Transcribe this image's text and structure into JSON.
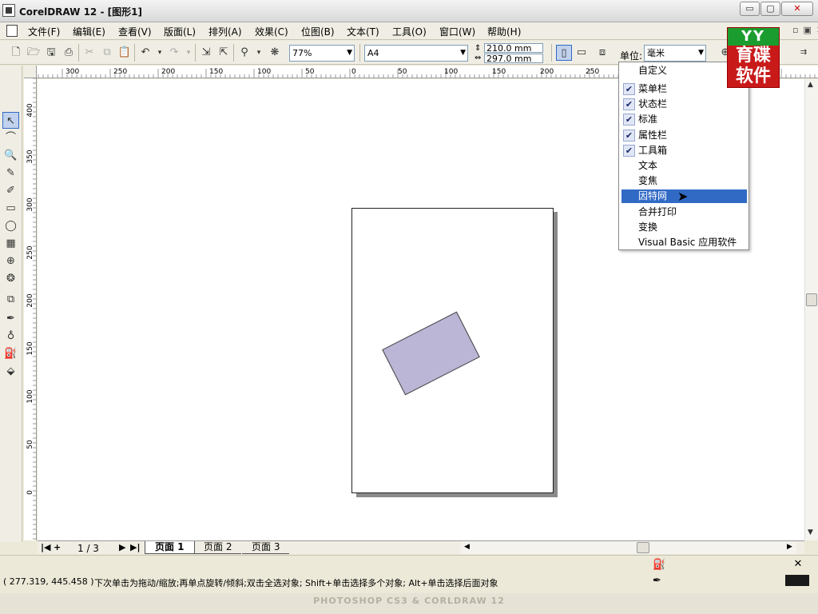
{
  "window": {
    "title": "CorelDRAW 12 - [图形1]",
    "min_glyph": "▭",
    "max_glyph": "▢",
    "close_glyph": "✕",
    "mdi_controls": "▫▣✕"
  },
  "menu": [
    "文件(F)",
    "编辑(E)",
    "查看(V)",
    "版面(L)",
    "排列(A)",
    "效果(C)",
    "位图(B)",
    "文本(T)",
    "工具(O)",
    "窗口(W)",
    "帮助(H)"
  ],
  "toolbar": {
    "zoom": "77%",
    "paper_size": "A4",
    "width": "210.0 mm",
    "height": "297.0 mm",
    "unit_label": "单位:",
    "unit_value": "毫米"
  },
  "logo": {
    "mark": "YY",
    "line1": "育碟",
    "line2": "软件"
  },
  "ruler_top_labels": [
    "300",
    "250",
    "200",
    "150",
    "100",
    "50",
    "0",
    "50",
    "100",
    "150",
    "200",
    "250"
  ],
  "ruler_left_labels": [
    "400",
    "350",
    "300",
    "250",
    "200",
    "150",
    "100",
    "50",
    "0"
  ],
  "dropdown": {
    "header": "自定义",
    "items": [
      {
        "label": "菜单栏",
        "checked": true
      },
      {
        "label": "状态栏",
        "checked": true
      },
      {
        "label": "标准",
        "checked": true
      },
      {
        "label": "属性栏",
        "checked": true
      },
      {
        "label": "工具箱",
        "checked": true
      },
      {
        "label": "文本",
        "checked": false
      },
      {
        "label": "变焦",
        "checked": false
      },
      {
        "label": "因特网",
        "checked": false,
        "highlighted": true
      },
      {
        "label": "合并打印",
        "checked": false
      },
      {
        "label": "变换",
        "checked": false
      },
      {
        "label": "Visual Basic 应用软件",
        "checked": false
      }
    ],
    "check_glyph": "✔"
  },
  "page_nav": {
    "count": "1 / 3",
    "first": "|◀",
    "add": "+",
    "next": "▶",
    "last": "▶|",
    "tabs": [
      "页面 1",
      "页面 2",
      "页面 3"
    ]
  },
  "status": {
    "coords": "( 277.319, 445.458 )",
    "hint": "下次单击为拖动/缩放;再单点旋转/倾斜;双击全选对象; Shift+单击选择多个对象; Alt+单击选择后面对象"
  },
  "footer": "PHOTOSHOP CS3 & CORLDRAW 12",
  "colors": {
    "shape_fill": "#bbb5d6",
    "menu_highlight": "#316ac5",
    "logo_red": "#c91a1a",
    "logo_green": "#1a9d2e"
  },
  "icons": {
    "tools": [
      "↖",
      "⌒",
      "🔍",
      "✎",
      "✐",
      "▭",
      "◯",
      "▦",
      "⊕",
      "❂",
      "⧉",
      "✒",
      "♁",
      "⛽",
      "⬙"
    ]
  }
}
